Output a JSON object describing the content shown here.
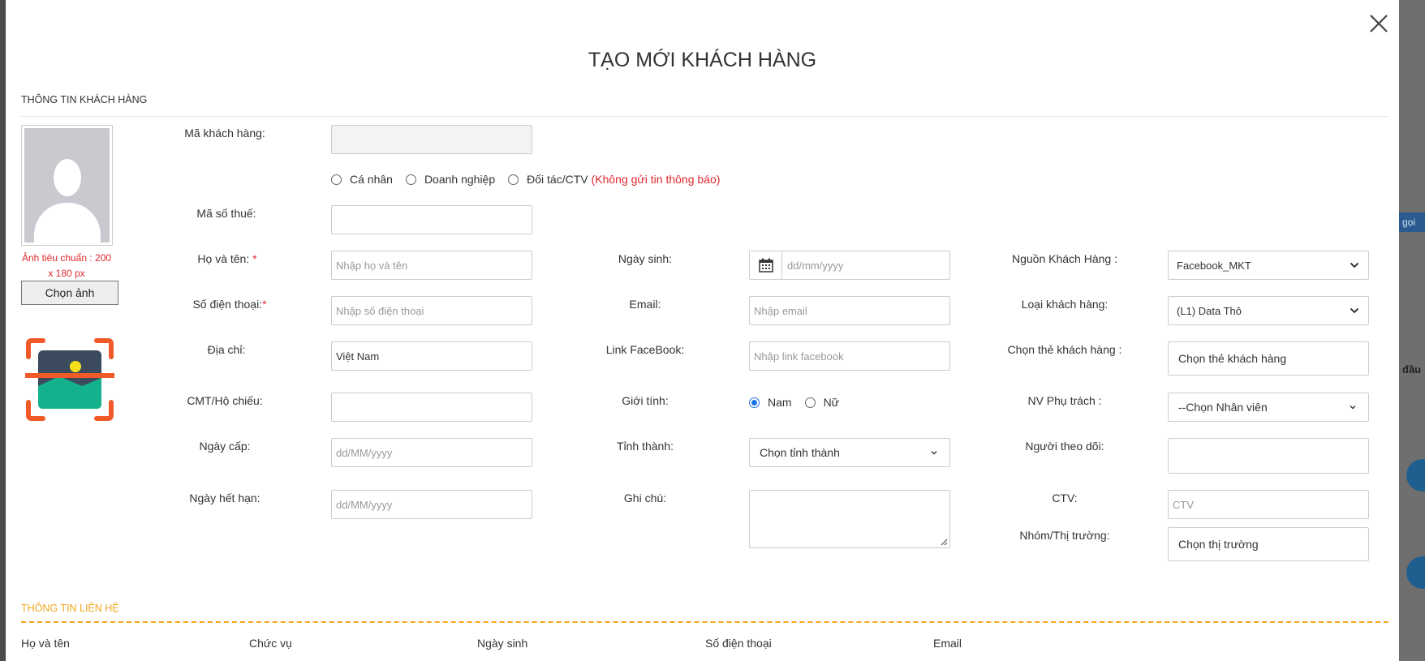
{
  "modal": {
    "title": "TẠO MỚI KHÁCH HÀNG",
    "section_customer": "THÔNG TIN KHÁCH HÀNG",
    "section_contact": "THÔNG TIN LIÊN HỆ"
  },
  "avatar": {
    "note": "Ảnh tiêu chuẩn : 200 x 180 px",
    "choose_label": "Chọn ảnh"
  },
  "form": {
    "customer_code": {
      "label": "Mã khách hàng:",
      "value": ""
    },
    "customer_type": {
      "options": [
        "Cá nhân",
        "Doanh nghiệp",
        "Đối tác/CTV"
      ],
      "note": "(Không gửi tin thông báo)"
    },
    "tax_code": {
      "label": "Mã số thuế:",
      "value": ""
    },
    "full_name": {
      "label": "Họ và tên:",
      "required": "*",
      "placeholder": "Nhập họ và tên"
    },
    "phone": {
      "label": "Số điện thoại:",
      "required": "*",
      "placeholder": "Nhập số điện thoại"
    },
    "address": {
      "label": "Địa chỉ:",
      "value": "Việt Nam"
    },
    "id_card": {
      "label": "CMT/Hộ chiếu:",
      "value": ""
    },
    "issue_date": {
      "label": "Ngày cấp:",
      "placeholder": "dd/MM/yyyy"
    },
    "expiry_date": {
      "label": "Ngày hết hạn:",
      "placeholder": "dd/MM/yyyy"
    },
    "birthday": {
      "label": "Ngày sinh:",
      "placeholder": "dd/mm/yyyy"
    },
    "email": {
      "label": "Email:",
      "placeholder": "Nhập email"
    },
    "facebook": {
      "label": "Link FaceBook:",
      "placeholder": "Nhập link facebook"
    },
    "gender": {
      "label": "Giới tính:",
      "options": [
        "Nam",
        "Nữ"
      ],
      "selected": "Nam"
    },
    "province": {
      "label": "Tỉnh thành:",
      "value": "Chọn tỉnh thành"
    },
    "note": {
      "label": "Ghi chú:",
      "value": ""
    },
    "source": {
      "label": "Nguồn Khách Hàng :",
      "value": "Facebook_MKT"
    },
    "customer_kind": {
      "label": "Loại khách hàng:",
      "value": "(L1) Data Thô"
    },
    "tags": {
      "label": "Chọn thẻ khách hàng :",
      "value": "Chọn thẻ khách hàng"
    },
    "staff": {
      "label": "NV Phụ trách :",
      "value": "--Chọn Nhân viên"
    },
    "follower": {
      "label": "Người theo dõi:",
      "value": ""
    },
    "ctv": {
      "label": "CTV:",
      "placeholder": "CTV"
    },
    "market": {
      "label": "Nhóm/Thị trường:",
      "value": "Chọn thị trường"
    }
  },
  "contact_columns": [
    "Họ và tên",
    "Chức vụ",
    "Ngày sinh",
    "Số điện thoại",
    "Email"
  ],
  "background": {
    "right_button": "gọi",
    "right_text": "đầu"
  },
  "colors": {
    "accent_orange": "#f3a71f",
    "required_red": "#e0282e",
    "radio_blue": "#1a73e8"
  }
}
